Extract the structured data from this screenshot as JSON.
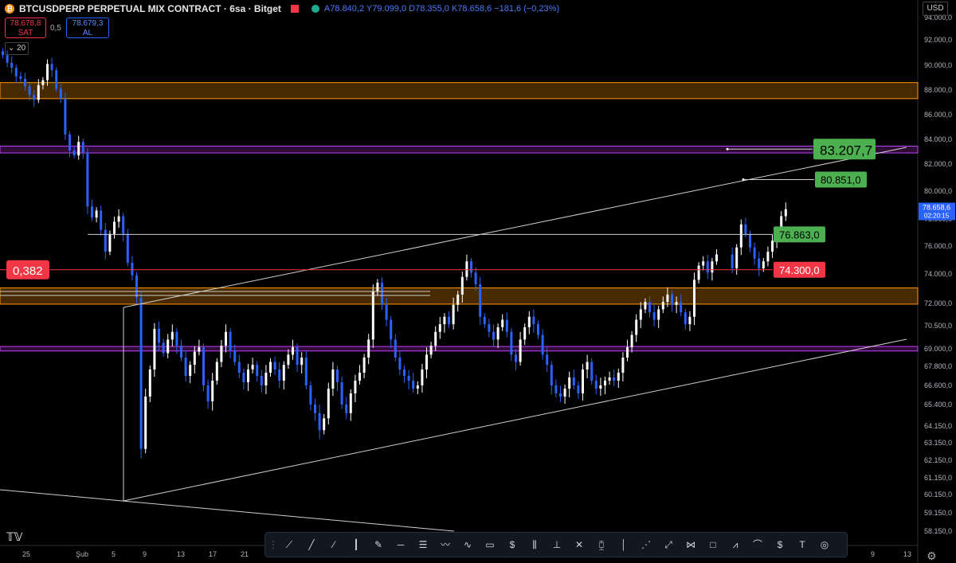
{
  "header": {
    "symbol": "BTCUSDPERP PERPETUAL MIX CONTRACT · 6sa · Bitget",
    "ohlc": "A78.840,2 Y79.099,0 D78.355,0 K78.658,6 −181,6 (−0,23%)"
  },
  "trade": {
    "sell_price": "78.678,8",
    "sell_label": "SAT",
    "spread": "0,5",
    "buy_price": "78.679,3",
    "buy_label": "AL"
  },
  "interval_badge": "20",
  "currency": "USD",
  "icons": [
    "bitcoin-icon",
    "flag-icon",
    "status-dot-icon",
    "chevron-down-icon",
    "tradingview-logo",
    "settings-gear-icon"
  ],
  "colors": {
    "background": "#000000",
    "candle_up": "#ffffff",
    "candle_down": "#2962ff",
    "orange_zone": "#ff9800",
    "purple_zone": "#9c27b0",
    "green_label": "#4caf50",
    "red_label": "#f23645"
  },
  "chart_data": {
    "type": "candlestick",
    "title": "BTCUSDPERP PERPETUAL MIX CONTRACT · 6sa · Bitget",
    "y_ticks": [
      "94.000,0",
      "92.000,0",
      "90.000,0",
      "88.000,0",
      "86.000,0",
      "84.000,0",
      "82.000,0",
      "80.000,0",
      "78.000,0",
      "76.000,0",
      "74.000,0",
      "72.000,0",
      "70.500,0",
      "69.000,0",
      "67.800,0",
      "66.600,0",
      "65.400,0",
      "64.150,0",
      "63.150,0",
      "62.150,0",
      "61.150,0",
      "60.150,0",
      "59.150,0",
      "58.150,0"
    ],
    "x_ticks": [
      "25",
      "Şub",
      "5",
      "9",
      "13",
      "17",
      "21",
      "9",
      "13"
    ],
    "last_price": "78.658,6",
    "countdown": "02:20:15",
    "closes": [
      90.8,
      90.2,
      89.8,
      89.1,
      88.9,
      88.3,
      87.6,
      87.2,
      88.4,
      88.8,
      90.1,
      89.6,
      88.1,
      87.3,
      84.4,
      83.1,
      82.7,
      83.8,
      82.9,
      78.9,
      78.1,
      78.6,
      77.2,
      75.6,
      76.9,
      77.8,
      78.2,
      76.9,
      74.8,
      73.9,
      72.4,
      62.8,
      65.9,
      67.6,
      70.3,
      69.4,
      68.7,
      69.6,
      70.1,
      69.2,
      68.4,
      67.2,
      67.9,
      68.8,
      69.1,
      66.6,
      65.6,
      66.9,
      68.1,
      69.2,
      70.1,
      68.9,
      68.1,
      67.4,
      66.8,
      67.6,
      67.9,
      67.2,
      66.6,
      67.4,
      68.1,
      67.6,
      66.9,
      67.9,
      68.6,
      69.1,
      67.9,
      68.4,
      66.6,
      65.4,
      64.9,
      63.9,
      64.6,
      66.4,
      67.6,
      66.8,
      65.4,
      64.9,
      66.1,
      66.9,
      67.4,
      68.4,
      69.6,
      72.8,
      73.4,
      71.9,
      70.9,
      69.6,
      68.4,
      67.6,
      67.2,
      66.9,
      66.4,
      66.6,
      67.6,
      68.6,
      69.2,
      70.1,
      70.6,
      71.1,
      70.6,
      71.9,
      72.6,
      73.8,
      74.9,
      74.1,
      73.3,
      71.1,
      70.6,
      70.1,
      69.6,
      70.4,
      70.9,
      70.1,
      68.6,
      68.1,
      69.6,
      70.4,
      71.1,
      70.6,
      69.9,
      68.6,
      67.9,
      66.6,
      66.1,
      65.9,
      66.4,
      67.1,
      66.6,
      66.1,
      67.6,
      68.1,
      66.9,
      66.4,
      66.6,
      66.9,
      67.1,
      66.9,
      67.4,
      68.4,
      69.1,
      69.9,
      70.9,
      71.6,
      72.1,
      71.4,
      70.9,
      71.6,
      72.1,
      72.6,
      71.9,
      72.1,
      71.4,
      70.6,
      71.1,
      73.6,
      74.6,
      74.9,
      74.1,
      74.9,
      75.4,
      74.4,
      75.9,
      77.6,
      76.9,
      75.9,
      75.1,
      74.4,
      74.9,
      75.6,
      76.4,
      77.1,
      78.2,
      78.7
    ]
  },
  "levels": {
    "orange_zones": [
      [
        87.3,
        88.6
      ],
      [
        71.95,
        73.05
      ]
    ],
    "purple_zones": [
      [
        82.9,
        83.45
      ],
      [
        68.85,
        69.15
      ]
    ],
    "hlines": [
      {
        "price": 76.863,
        "label": "76.863,0"
      },
      {
        "price": 74.3,
        "label": "74.300,0",
        "fib": "0,382"
      },
      {
        "price": 83.2077,
        "label": "83.207,7"
      },
      {
        "price": 80.851,
        "label": "80.851,0"
      }
    ]
  },
  "drawings": {
    "upper_trendline": "A",
    "lower_trendline": "B"
  }
}
